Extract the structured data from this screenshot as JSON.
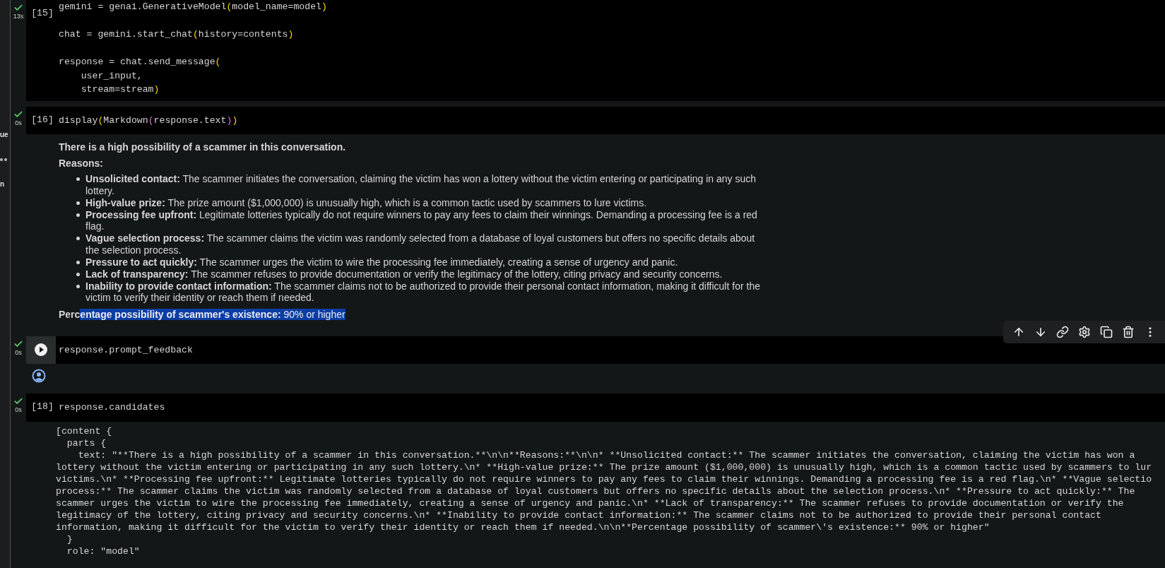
{
  "sidebar_fragments": [
    {
      "kind": "text",
      "text": "ue"
    },
    {
      "kind": "dots"
    },
    {
      "kind": "text",
      "text": "n"
    }
  ],
  "cells": [
    {
      "kind": "code",
      "count": "[15]",
      "status": "13s",
      "done": true,
      "blocks": [
        [
          "gemini = genai.GenerativeModel(model_name=model)"
        ],
        [
          "chat = gemini.start_chat(history=contents)"
        ],
        [
          "response = chat.send_message(",
          "    user_input,",
          "    stream=stream)"
        ]
      ]
    },
    {
      "kind": "code",
      "count": "[16]",
      "status": "0s",
      "done": true,
      "blocks": [
        [
          "display(Markdown(response.text))"
        ]
      ],
      "output": {
        "kind": "markdown",
        "title": "There is a high possibility of a scammer in this conversation.",
        "subtitle": "Reasons:",
        "items": [
          "**Unsolicited contact:** The scammer initiates the conversation, claiming the victim has won a lottery without the victim entering or participating in any such lottery.",
          "**High-value prize:** The prize amount ($1,000,000) is unusually high, which is a common tactic used by scammers to lure victims.",
          "**Processing fee upfront:** Legitimate lotteries typically do not require winners to pay any fees to claim their winnings. Demanding a processing fee is a red flag.",
          "**Vague selection process:** The scammer claims the victim was randomly selected from a database of loyal customers but offers no specific details about the selection process.",
          "**Pressure to act quickly:** The scammer urges the victim to wire the processing fee immediately, creating a sense of urgency and panic.",
          "**Lack of transparency:** The scammer refuses to provide documentation or verify the legitimacy of the lottery, citing privacy and security concerns.",
          "**Inability to provide contact information:** The scammer claims not to be authorized to provide their personal contact information, making it difficult for the victim to verify their identity or reach them if needed."
        ],
        "conclusion": {
          "unselected_part": "**Perc**",
          "selected_part": "**entage possibility of scammer's existence:** 90% or higher"
        }
      }
    },
    {
      "kind": "code",
      "status": "0s",
      "done": true,
      "hovered": true,
      "blocks": [
        [
          "response.prompt_feedback"
        ]
      ],
      "output": {
        "kind": "user"
      }
    },
    {
      "kind": "code",
      "count": "[18]",
      "status": "0s",
      "done": true,
      "blocks": [
        [
          "response.candidates"
        ]
      ],
      "output": {
        "kind": "text",
        "lines": [
          "[content {",
          "  parts {",
          "    text: \"**There is a high possibility of a scammer in this conversation.**\\n\\n**Reasons:**\\n\\n* **Unsolicited contact:** The scammer initiates the conversation, claiming the victim has won a",
          "lottery without the victim entering or participating in any such lottery.\\n* **High-value prize:** The prize amount ($1,000,000) is unusually high, which is a common tactic used by scammers to lur",
          "victims.\\n* **Processing fee upfront:** Legitimate lotteries typically do not require winners to pay any fees to claim their winnings. Demanding a processing fee is a red flag.\\n* **Vague selectio",
          "process:** The scammer claims the victim was randomly selected from a database of loyal customers but offers no specific details about the selection process.\\n* **Pressure to act quickly:** The",
          "scammer urges the victim to wire the processing fee immediately, creating a sense of urgency and panic.\\n* **Lack of transparency:** The scammer refuses to provide documentation or verify the",
          "legitimacy of the lottery, citing privacy and security concerns.\\n* **Inability to provide contact information:** The scammer claims not to be authorized to provide their personal contact",
          "information, making it difficult for the victim to verify their identity or reach them if needed.\\n\\n**Percentage possibility of scammer\\'s existence:** 90% or higher\"",
          "  }",
          "  role: \"model\""
        ]
      }
    }
  ]
}
